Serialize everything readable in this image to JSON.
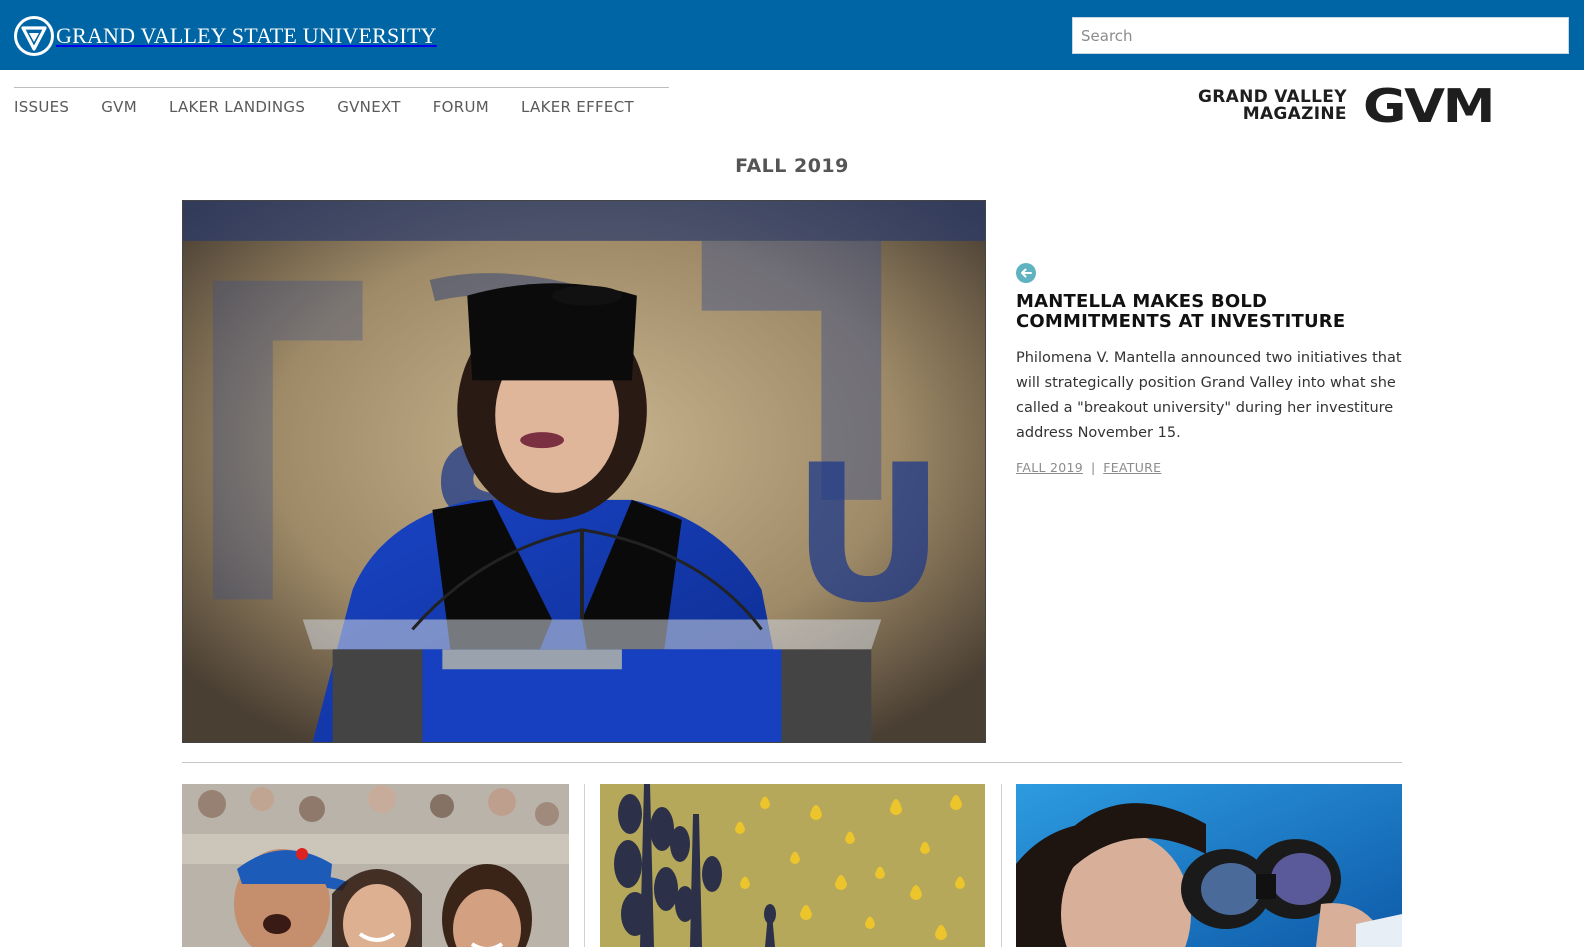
{
  "header": {
    "university_name": "Grand Valley State University",
    "search_placeholder": "Search",
    "brand_color": "#0065a4"
  },
  "nav": {
    "items": [
      {
        "label": "ISSUES"
      },
      {
        "label": "GVM"
      },
      {
        "label": "LAKER LANDINGS"
      },
      {
        "label": "GVNEXT"
      },
      {
        "label": "FORUM"
      },
      {
        "label": "LAKER EFFECT"
      }
    ]
  },
  "brand": {
    "line1": "GRAND VALLEY",
    "line2": "MAGAZINE",
    "mark": "GVM"
  },
  "issue": {
    "title": "FALL 2019"
  },
  "feature": {
    "icon": "arrow-left-circle-icon",
    "headline": "MANTELLA MAKES BOLD COMMITMENTS AT INVESTITURE",
    "summary": "Philomena V. Mantella announced two initiatives that will strategically position Grand Valley into what she called a \"breakout university\" during her investiture address November 15.",
    "tag_issue": "FALL 2019",
    "tag_separator": "|",
    "tag_type": "FEATURE",
    "accent_color": "#5fb3c0"
  },
  "cards": [
    {
      "image": "crowd-photo"
    },
    {
      "image": "plants-illustration"
    },
    {
      "image": "binoculars-photo"
    }
  ]
}
